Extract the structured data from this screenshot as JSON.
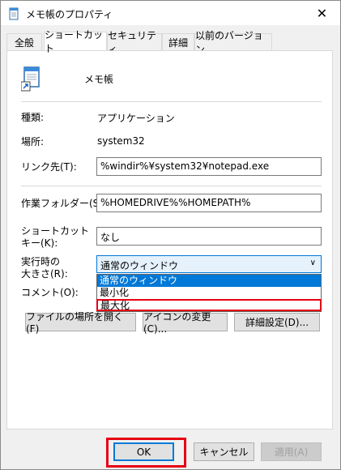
{
  "window": {
    "title": "メモ帳のプロパティ",
    "close": "✕"
  },
  "tabs": [
    {
      "label": "全般"
    },
    {
      "label": "ショートカット"
    },
    {
      "label": "セキュリティ"
    },
    {
      "label": "詳細"
    },
    {
      "label": "以前のバージョン"
    }
  ],
  "shortcut": {
    "name": "メモ帳",
    "type_label": "種類:",
    "type_value": "アプリケーション",
    "location_label": "場所:",
    "location_value": "system32",
    "target_label": "リンク先(T):",
    "target_value": "%windir%¥system32¥notepad.exe",
    "workdir_label": "作業フォルダー(S):",
    "workdir_value": "%HOMEDRIVE%%HOMEPATH%",
    "hotkey_label1": "ショートカット",
    "hotkey_label2": "キー(K):",
    "hotkey_value": "なし",
    "run_label1": "実行時の",
    "run_label2": "大きさ(R):",
    "run_value": "通常のウィンドウ",
    "run_options": [
      "通常のウィンドウ",
      "最小化",
      "最大化"
    ],
    "comment_label": "コメント(O):",
    "open_location": "ファイルの場所を開く(F)",
    "change_icon": "アイコンの変更(C)...",
    "advanced": "詳細設定(D)..."
  },
  "footer": {
    "ok": "OK",
    "cancel": "キャンセル",
    "apply": "適用(A)"
  },
  "colors": {
    "accent": "#0078d7",
    "highlight": "#e60012"
  }
}
